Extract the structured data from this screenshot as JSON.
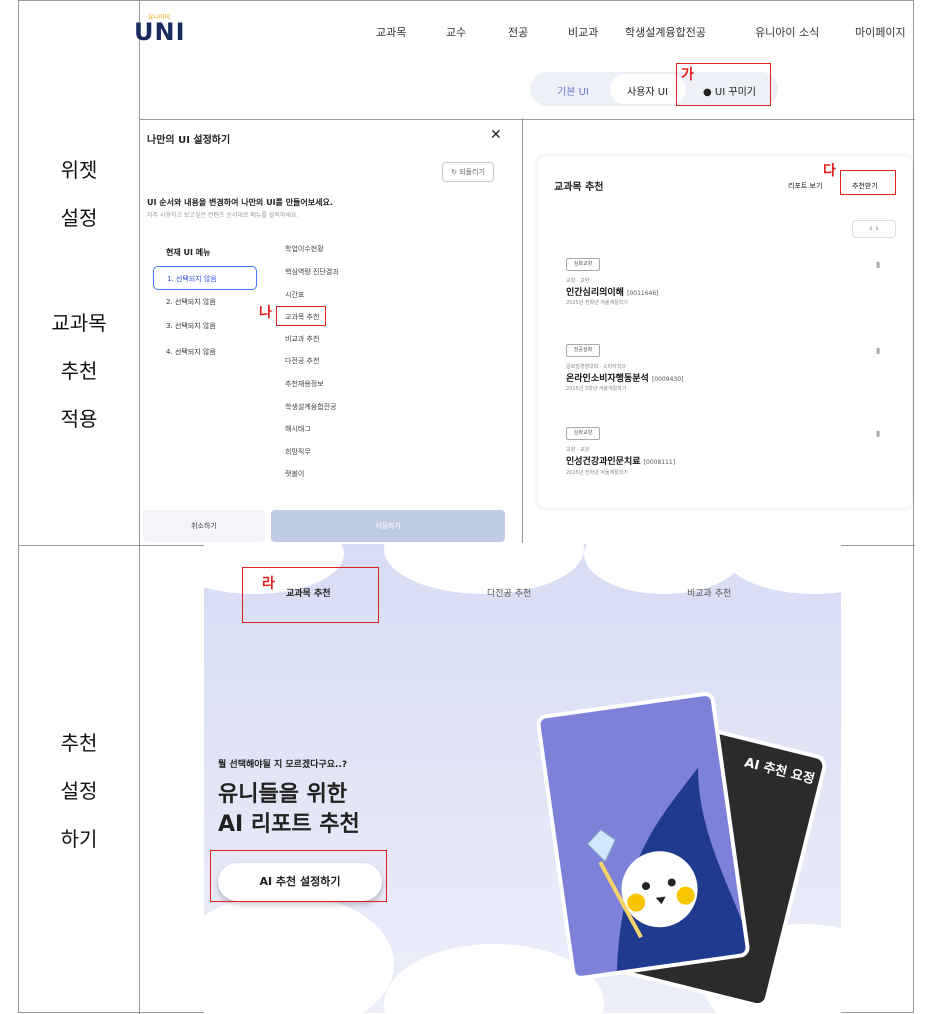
{
  "side_labels": {
    "widget": [
      "위젯",
      "설정"
    ],
    "course": [
      "교과목",
      "추천",
      "적용"
    ],
    "recommend": [
      "추천",
      "설정",
      "하기"
    ]
  },
  "annotations": {
    "ga": "가",
    "na": "나",
    "da": "다",
    "ra": "라"
  },
  "header": {
    "logo": "UNI",
    "logo_small": "유니아이",
    "nav": [
      "교과목",
      "교수",
      "전공",
      "비교과",
      "학생설계융합전공",
      "유니아이 소식",
      "마이페이지"
    ]
  },
  "ui_toggle": {
    "basic": "기본 UI",
    "user": "사용자 UI",
    "decorate": "UI 꾸미기"
  },
  "panel": {
    "title": "나만의 UI 설정하기",
    "close": "✕",
    "reset": "되돌리기",
    "desc": "UI 순서와 내용을 변경하여 나만의 UI를 만들어보세요.",
    "desc_sub": "자주 사용하고 보고싶은 컨텐츠 순서대로 메뉴를 클릭하세요.",
    "current_header": "현재 UI 메뉴",
    "current": [
      "1. 선택되지 않음",
      "2. 선택되지 않음",
      "3. 선택되지 않음",
      "4. 선택되지 않음"
    ],
    "options": [
      "학업이수현황",
      "핵심역량 진단결과",
      "시간표",
      "교과목 추천",
      "비교과 추천",
      "다전공 추천",
      "추천재용정보",
      "학생설계융합전공",
      "해시태그",
      "희망직무",
      "랫볼이"
    ],
    "cancel": "취소하기",
    "save": "저장하기"
  },
  "card": {
    "title": "교과목 추천",
    "report_btn": "리포트 보기",
    "recommend_btn": "추천받기",
    "pager": "‹  ›",
    "courses": [
      {
        "tag": "심화교양",
        "category": "교양 · 교양",
        "name": "인간심리의이해",
        "code": "[0011646]",
        "year": "2025년 전학년 겨울계절학기"
      },
      {
        "tag": "전공심화",
        "category": "글로벌경영대학 · 소비자학과",
        "name": "온라인소비자행동분석",
        "code": "[0009430]",
        "year": "2025년 3학년 겨울계절학기"
      },
      {
        "tag": "심화교양",
        "category": "교양 · 교양",
        "name": "인성건강과인문치료",
        "code": "[0008111]",
        "year": "2025년 전학년 겨울계절학기"
      }
    ]
  },
  "bottom": {
    "tabs": [
      "교과목 추천",
      "다전공 추천",
      "비교과 추천"
    ],
    "small": "뭘 선택해야될 지 모르겠다구요..?",
    "big1": "유니들을 위한",
    "big2": "AI 리포트 추천",
    "button": "AI 추천 설정하기",
    "card_label": "AI 추천 요정"
  },
  "colors": {
    "annotation": "#e02020",
    "accent": "#3355dd",
    "navy": "#1a2b5e"
  }
}
